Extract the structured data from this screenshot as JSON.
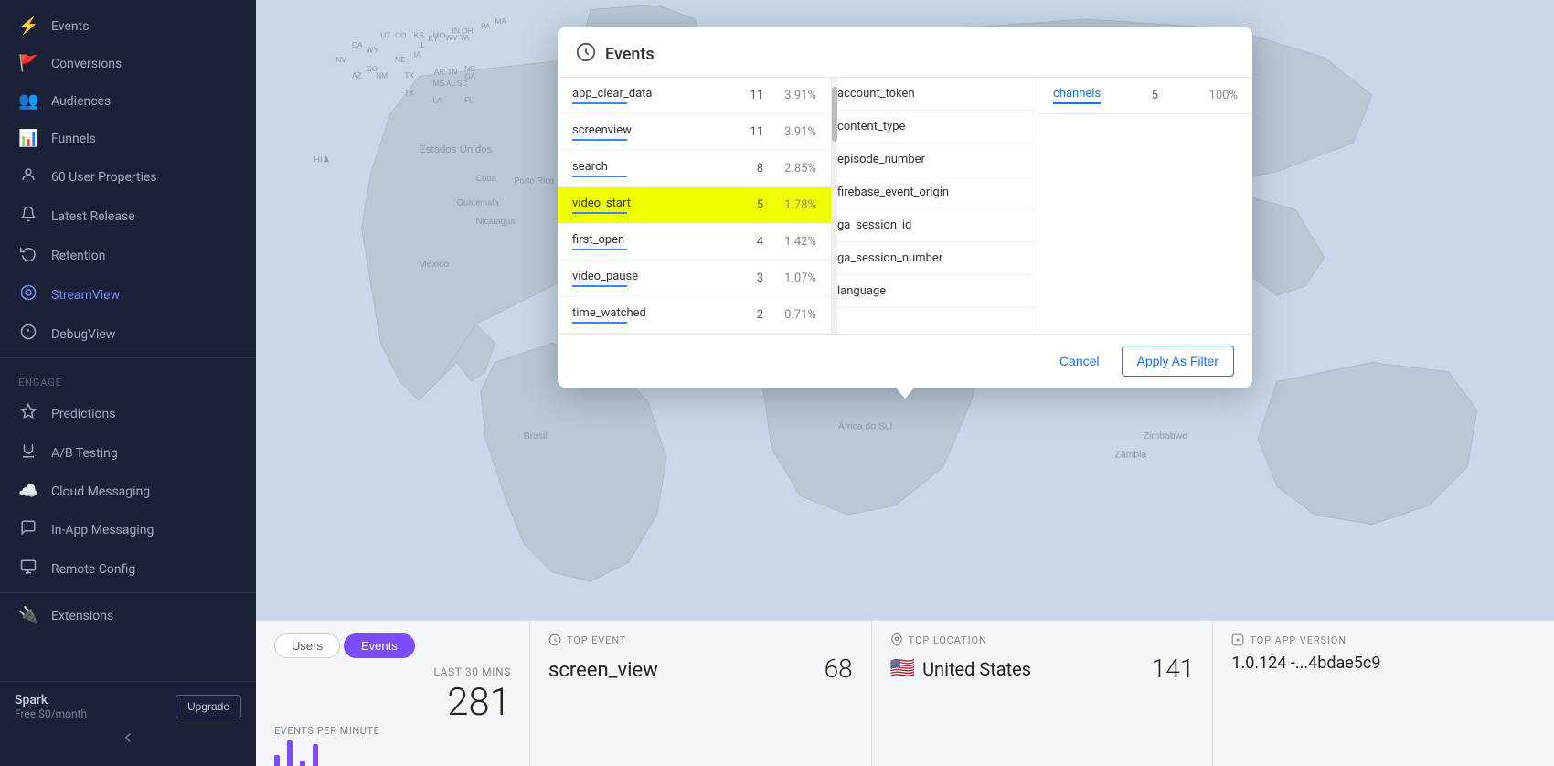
{
  "sidebar": {
    "items_top": [
      {
        "label": "Events",
        "icon": "⚡",
        "active": false
      },
      {
        "label": "Conversions",
        "icon": "🚩",
        "active": false
      },
      {
        "label": "Audiences",
        "icon": "👥",
        "active": false
      },
      {
        "label": "Funnels",
        "icon": "📊",
        "active": false
      },
      {
        "label": "User Properties",
        "icon": "⚙️",
        "active": false,
        "badge": "60"
      },
      {
        "label": "Latest Release",
        "icon": "🔔",
        "active": false
      },
      {
        "label": "Retention",
        "icon": "↩️",
        "active": false
      },
      {
        "label": "StreamView",
        "icon": "🔵",
        "active": true
      },
      {
        "label": "DebugView",
        "icon": "🐛",
        "active": false
      }
    ],
    "engage_label": "Engage",
    "items_engage": [
      {
        "label": "Predictions",
        "icon": "🔮",
        "active": false
      },
      {
        "label": "A/B Testing",
        "icon": "🧪",
        "active": false
      },
      {
        "label": "Cloud Messaging",
        "icon": "☁️",
        "active": false
      },
      {
        "label": "In-App Messaging",
        "icon": "💬",
        "active": false
      },
      {
        "label": "Remote Config",
        "icon": "⚙️",
        "active": false
      }
    ],
    "extensions_label": "Extensions",
    "spark": {
      "title": "Spark",
      "subtitle": "Free $0/month",
      "upgrade_label": "Upgrade"
    }
  },
  "modal": {
    "title": "Events",
    "events": [
      {
        "name": "app_clear_data",
        "count": 11,
        "pct": "3.91%",
        "highlighted": false
      },
      {
        "name": "screenview",
        "count": 11,
        "pct": "3.91%",
        "highlighted": false
      },
      {
        "name": "search",
        "count": 8,
        "pct": "2.85%",
        "highlighted": false
      },
      {
        "name": "video_start",
        "count": 5,
        "pct": "1.78%",
        "highlighted": true
      },
      {
        "name": "first_open",
        "count": 4,
        "pct": "1.42%",
        "highlighted": false
      },
      {
        "name": "video_pause",
        "count": 3,
        "pct": "1.07%",
        "highlighted": false
      },
      {
        "name": "time_watched",
        "count": 2,
        "pct": "0.71%",
        "highlighted": false
      }
    ],
    "params": [
      {
        "name": "account_token"
      },
      {
        "name": "content_type"
      },
      {
        "name": "episode_number"
      },
      {
        "name": "firebase_event_origin"
      },
      {
        "name": "ga_session_id"
      },
      {
        "name": "ga_session_number"
      },
      {
        "name": "language"
      }
    ],
    "channel_col": {
      "title": "channels",
      "count": 5,
      "pct": "100%"
    },
    "cancel_label": "Cancel",
    "apply_label": "Apply As Filter"
  },
  "bottom": {
    "tab_users": "Users",
    "tab_events": "Events",
    "last_label": "LAST 30 MINS",
    "epm_label": "EVENTS PER MINUTE",
    "big_number": "281",
    "bars": [
      30,
      60,
      20,
      55
    ],
    "top_event_header": "TOP EVENT",
    "top_event_name": "screen_view",
    "top_event_count": "68",
    "top_location_header": "TOP LOCATION",
    "top_location_flag": "🇺🇸",
    "top_location_name": "United States",
    "top_location_count": "141",
    "top_app_header": "TOP APP VERSION",
    "top_app_version": "1.0.124 -...4bdae5c9"
  }
}
